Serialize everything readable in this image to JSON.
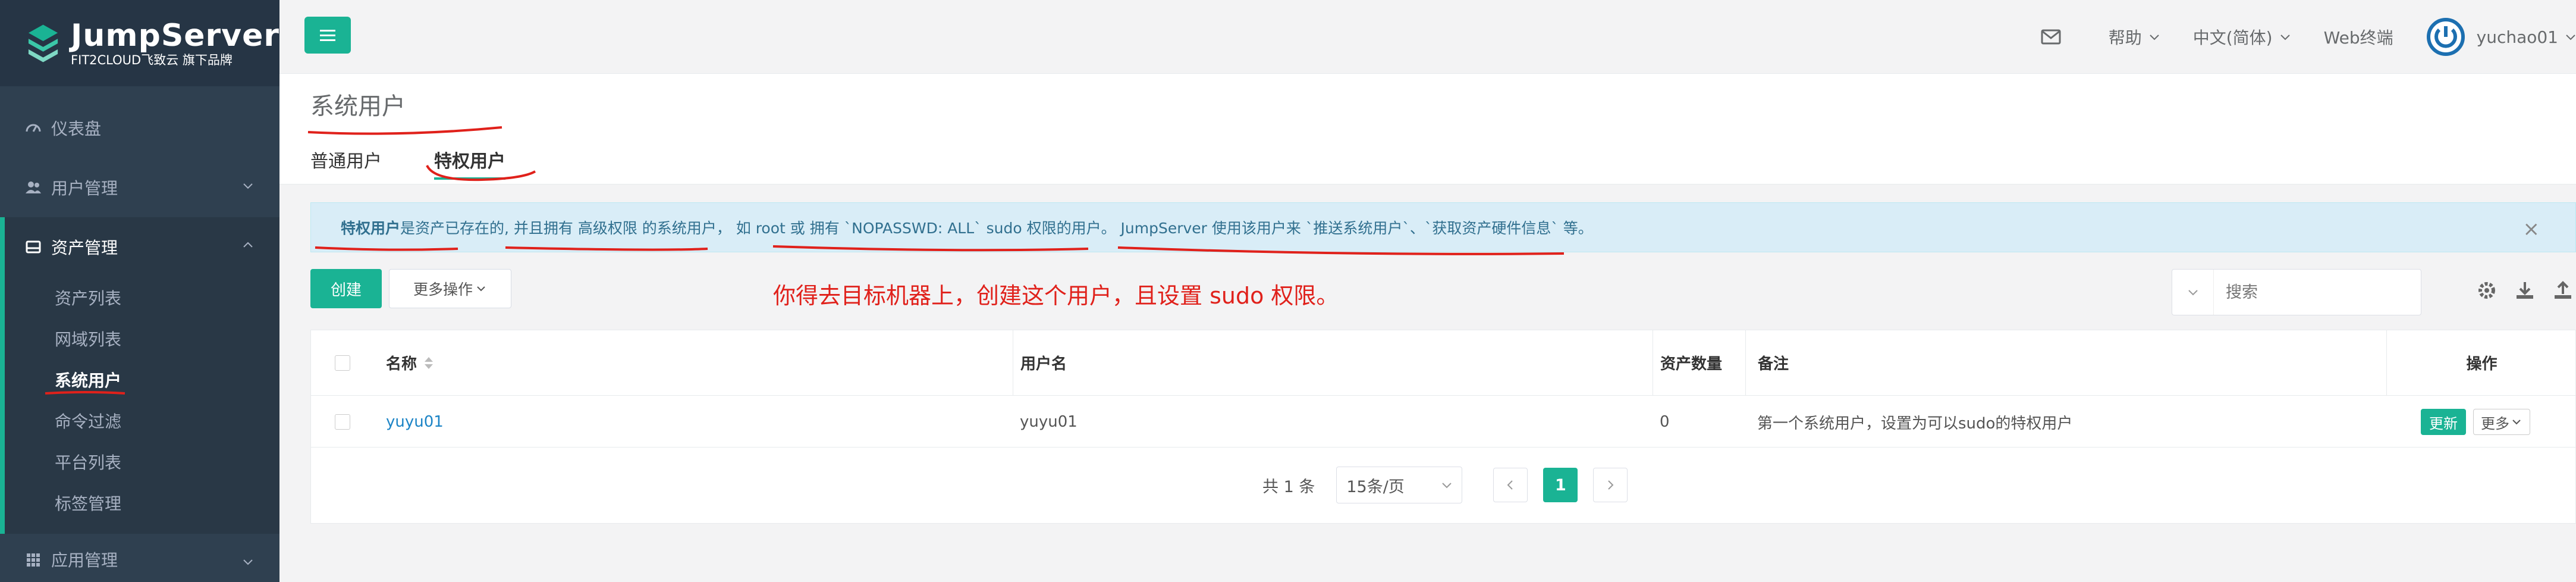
{
  "app": {
    "logo_title": "JumpServer",
    "logo_subtitle": "FIT2CLOUD飞致云 旗下品牌"
  },
  "sidebar": {
    "dashboard": "仪表盘",
    "users": "用户管理",
    "assets": "资产管理",
    "asset_children": [
      "资产列表",
      "网域列表",
      "系统用户",
      "命令过滤",
      "平台列表",
      "标签管理"
    ],
    "active_child": "系统用户",
    "apps": "应用管理"
  },
  "topbar": {
    "help": "帮助",
    "language": "中文(简体)",
    "web_terminal": "Web终端",
    "username": "yuchao01"
  },
  "page": {
    "title": "系统用户",
    "tabs": [
      "普通用户",
      "特权用户"
    ],
    "active_tab": "特权用户"
  },
  "alert": {
    "bold_prefix": "特权用户",
    "text": " 是资产已存在的, 并且拥有 高级权限 的系统用户， 如 root 或 拥有 `NOPASSWD: ALL` sudo 权限的用户。 JumpServer 使用该用户来 `推送系统用户`、`获取资产硬件信息` 等。",
    "close": "×"
  },
  "toolbar": {
    "create": "创建",
    "more_actions": "更多操作",
    "annotation": "你得去目标机器上，创建这个用户，且设置 sudo 权限。",
    "search_placeholder": "搜索"
  },
  "table": {
    "columns": [
      "名称",
      "用户名",
      "资产数量",
      "备注",
      "操作"
    ],
    "rows": [
      {
        "name": "yuyu01",
        "username": "yuyu01",
        "asset_count": "0",
        "comment": "第一个系统用户，设置为可以sudo的特权用户",
        "update": "更新",
        "more": "更多"
      }
    ]
  },
  "pagination": {
    "total": "共 1 条",
    "page_size": "15条/页",
    "current_page": "1"
  },
  "colors": {
    "sidebar_bg": "#2f4050",
    "accent": "#1ab394",
    "annotation_red": "#e0211b",
    "link": "#1c84c6"
  }
}
